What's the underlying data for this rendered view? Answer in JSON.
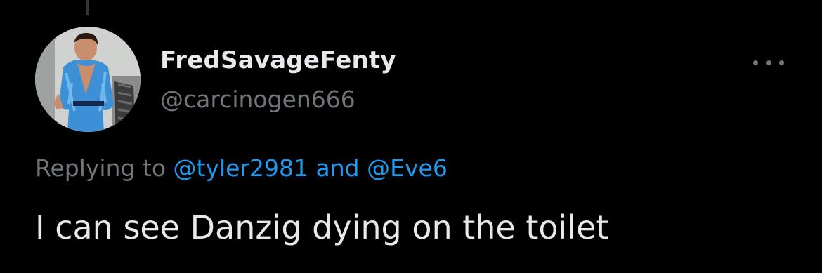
{
  "tweet": {
    "author": {
      "display_name": "FredSavageFenty",
      "handle": "@carcinogen666",
      "avatar": "profile-photo"
    },
    "more_icon": "ellipsis-icon",
    "reply": {
      "prefix": "Replying to",
      "mentions": [
        "@tyler2981",
        "@Eve6"
      ],
      "connector": "and"
    },
    "text": "I can see Danzig dying on the toilet"
  },
  "colors": {
    "background": "#000000",
    "primary_text": "#e7e9ea",
    "secondary_text": "#71767b",
    "link": "#1d9bf0"
  }
}
